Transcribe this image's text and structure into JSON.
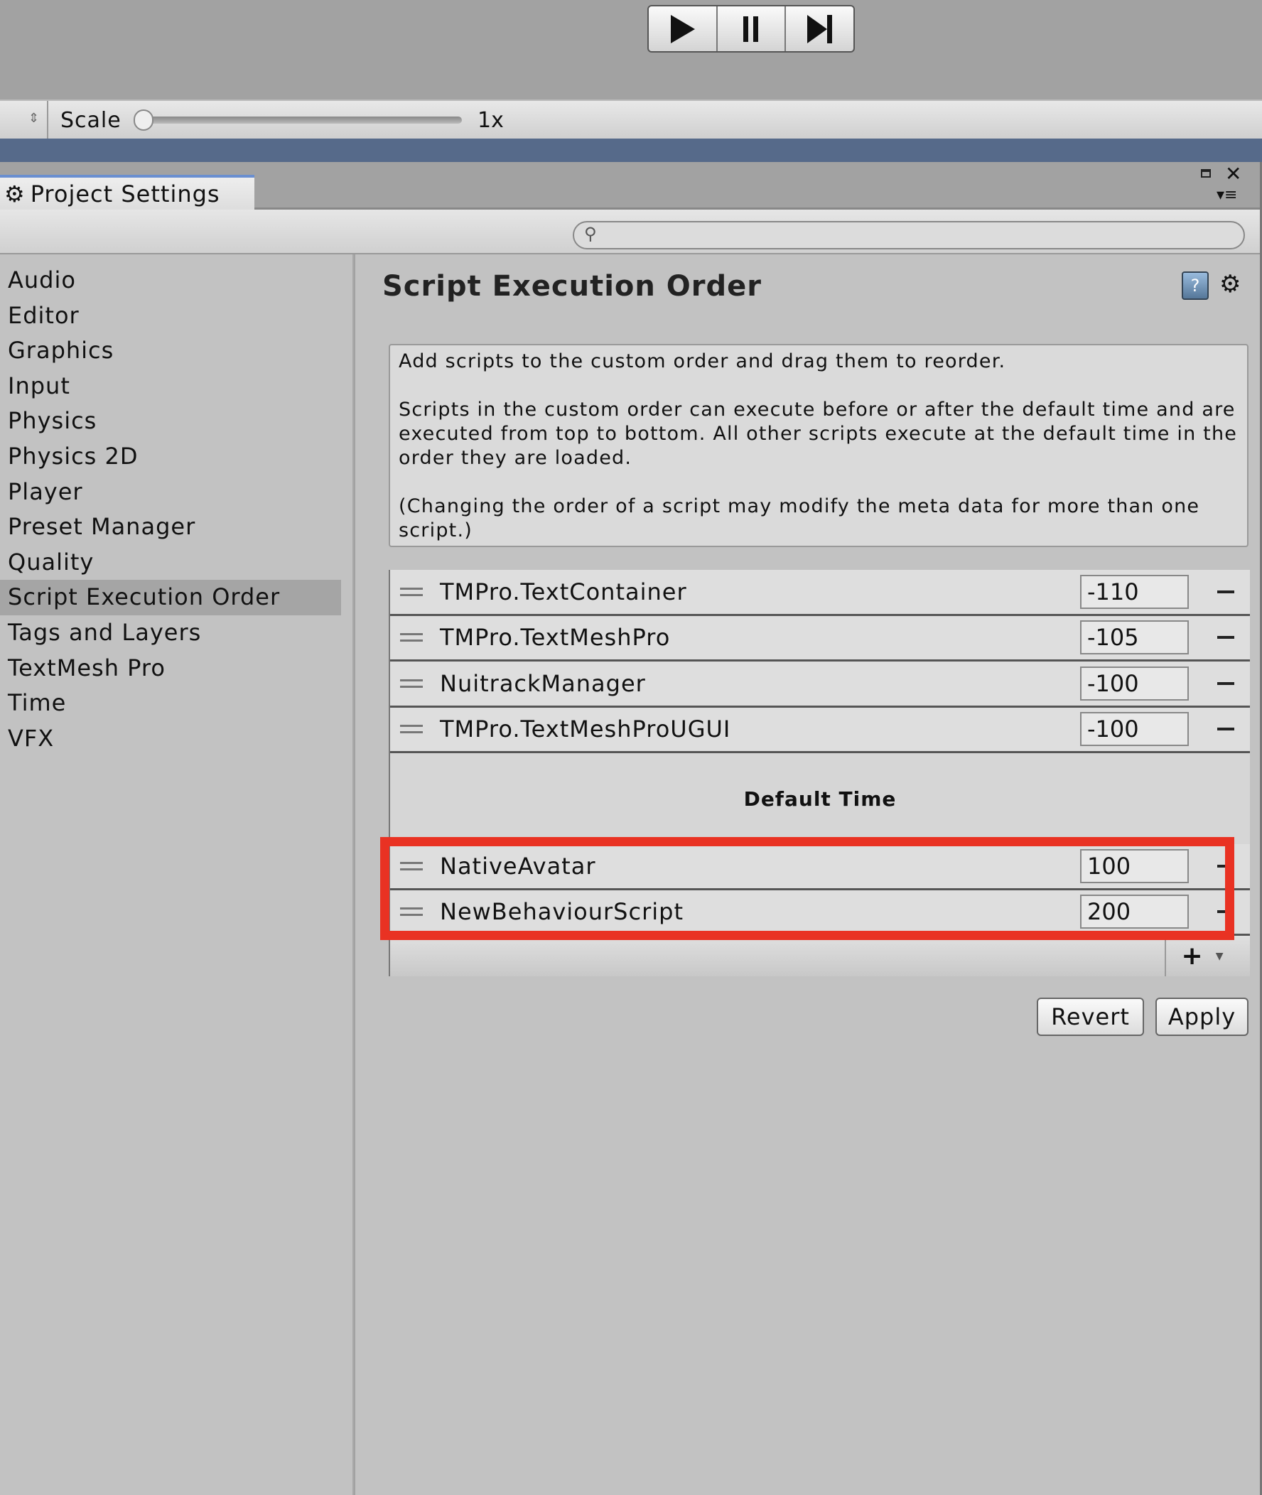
{
  "toolbar": {
    "play": "play-icon",
    "pause": "pause-icon",
    "step": "step-icon"
  },
  "scale": {
    "label": "Scale",
    "value": "1x",
    "slider_fraction": 0
  },
  "window": {
    "tab_title": "Project Settings"
  },
  "search": {
    "placeholder": ""
  },
  "sidebar": {
    "items": [
      {
        "label": "Audio"
      },
      {
        "label": "Editor"
      },
      {
        "label": "Graphics"
      },
      {
        "label": "Input"
      },
      {
        "label": "Physics"
      },
      {
        "label": "Physics 2D"
      },
      {
        "label": "Player"
      },
      {
        "label": "Preset Manager"
      },
      {
        "label": "Quality"
      },
      {
        "label": "Script Execution Order",
        "selected": true
      },
      {
        "label": "Tags and Layers"
      },
      {
        "label": "TextMesh Pro"
      },
      {
        "label": "Time"
      },
      {
        "label": "VFX"
      }
    ]
  },
  "main": {
    "title": "Script Execution Order",
    "help": [
      "Add scripts to the custom order and drag them to reorder.",
      "Scripts in the custom order can execute before or after the default time and are executed from top to bottom. All other scripts execute at the default time in the order they are loaded.",
      "(Changing the order of a script may modify the meta data for more than one script.)"
    ],
    "before": [
      {
        "name": "TMPro.TextContainer",
        "order": "-110"
      },
      {
        "name": "TMPro.TextMeshPro",
        "order": "-105"
      },
      {
        "name": "NuitrackManager",
        "order": "-100"
      },
      {
        "name": "TMPro.TextMeshProUGUI",
        "order": "-100"
      }
    ],
    "default_label": "Default Time",
    "after": [
      {
        "name": "NativeAvatar",
        "order": "100"
      },
      {
        "name": "NewBehaviourScript",
        "order": "200"
      }
    ],
    "add_label": "+",
    "revert": "Revert",
    "apply": "Apply"
  },
  "highlight_color": "#e93223"
}
